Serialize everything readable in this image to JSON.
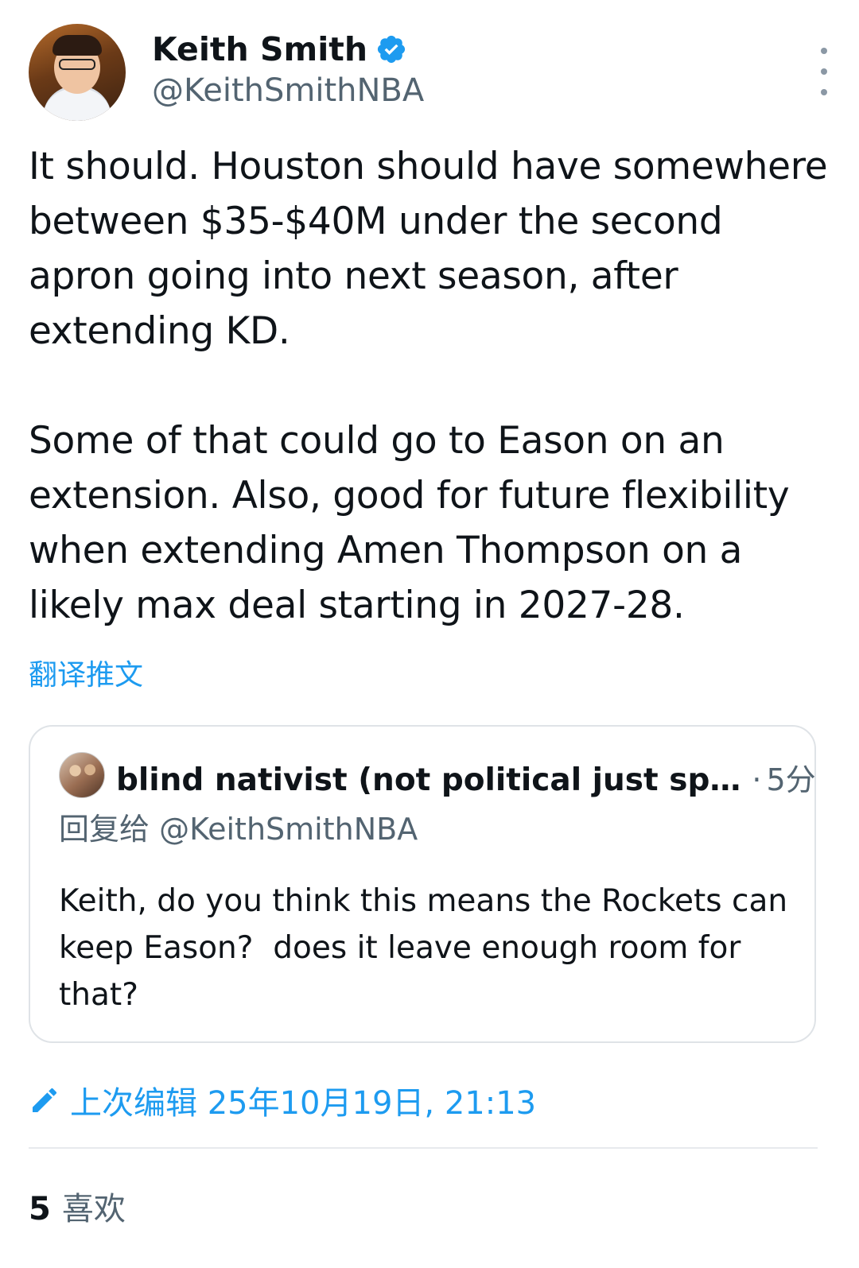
{
  "author": {
    "name": "Keith Smith",
    "handle": "@KeithSmithNBA"
  },
  "tweet": {
    "text": "It should. Houston should have somewhere between $35-$40M under the second apron going into next season, after extending KD.\n\nSome of that could go to Eason on an extension. Also, good for future flexibility when extending Amen Thompson on a likely max deal starting in 2027-28.",
    "translate_label": "翻译推文"
  },
  "quote": {
    "name": "blind nativist (not political just sp…",
    "dot": "·",
    "time": "5分",
    "reply_to": "回复给 @KeithSmithNBA",
    "text": "Keith, do you think this means the Rockets can keep Eason?  does it leave enough room for that?"
  },
  "edited": {
    "label": "上次编辑 25年10月19日, 21:13"
  },
  "likes": {
    "count": "5",
    "label": "喜欢"
  },
  "colors": {
    "accent": "#1d9bf0",
    "secondary_text": "#536471",
    "primary_text": "#0f1419",
    "border": "#dfe3e7"
  },
  "icons": [
    "verified-badge-icon",
    "more-options-icon",
    "edit-pencil-icon"
  ]
}
